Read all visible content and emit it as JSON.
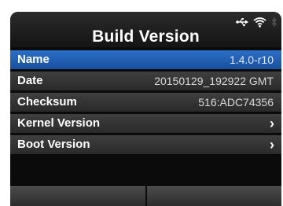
{
  "header": {
    "title": "Build Version",
    "status_icons": [
      "usb-icon",
      "wifi-icon",
      "bluetooth-icon"
    ]
  },
  "rows": [
    {
      "label": "Name",
      "value": "1.4.0-r10",
      "selected": true
    },
    {
      "label": "Date",
      "value": "20150129_192922 GMT",
      "selected": false
    },
    {
      "label": "Checksum",
      "value": "516:ADC74356",
      "selected": false
    },
    {
      "label": "Kernel Version",
      "value": "",
      "chevron": true,
      "selected": false
    },
    {
      "label": "Boot Version",
      "value": "",
      "chevron": true,
      "selected": false
    }
  ],
  "colors": {
    "background": "#0b0b0b",
    "selected_row": "#2366bd",
    "row": "#363636",
    "text": "#ffffff"
  }
}
